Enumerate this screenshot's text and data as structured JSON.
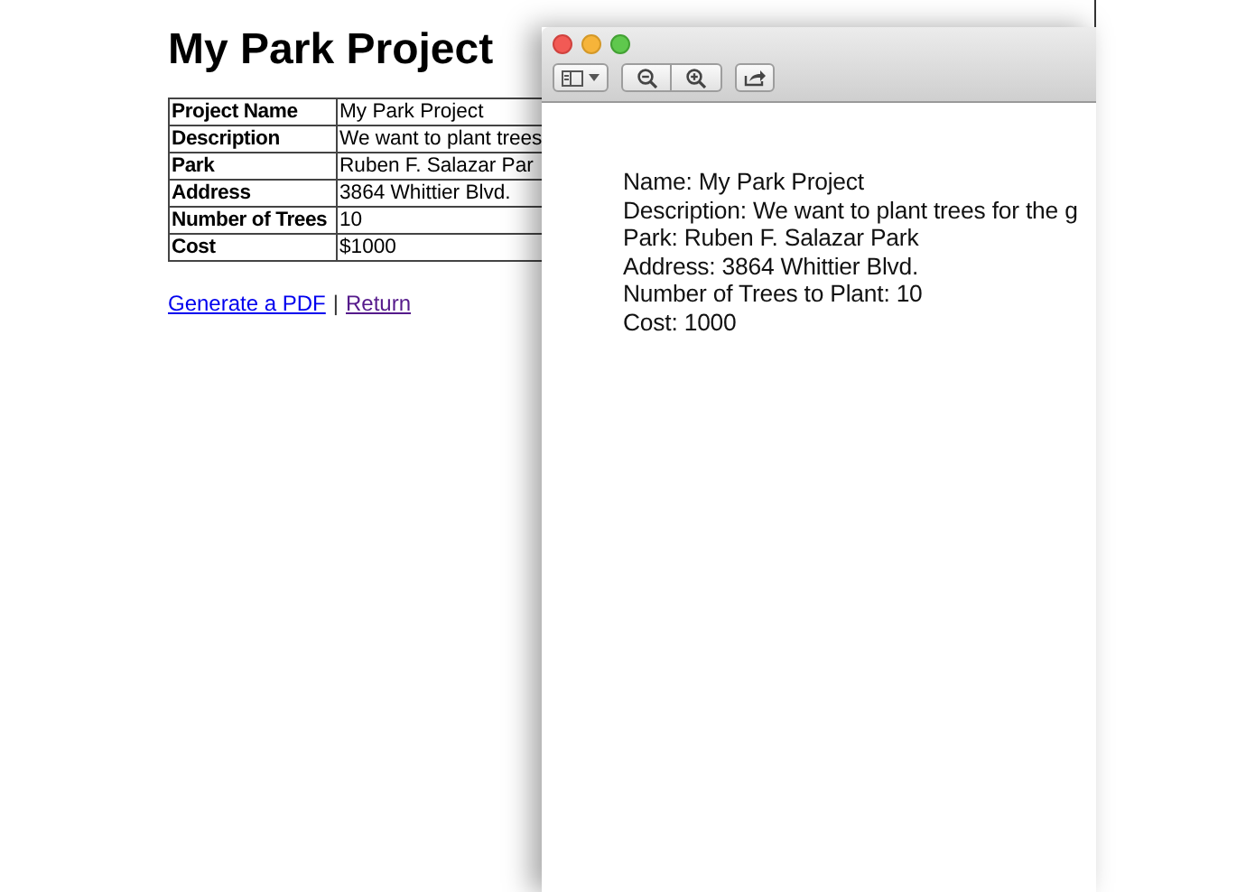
{
  "page": {
    "heading": "My Park Project",
    "table": {
      "rows": [
        {
          "label": "Project Name",
          "value": "My Park Project"
        },
        {
          "label": "Description",
          "value": "We want to plant trees"
        },
        {
          "label": "Park",
          "value": "Ruben F. Salazar Par"
        },
        {
          "label": "Address",
          "value": "3864 Whittier Blvd."
        },
        {
          "label": "Number of Trees",
          "value": "10"
        },
        {
          "label": "Cost",
          "value": "$1000"
        }
      ]
    },
    "links": [
      {
        "label": "Generate a PDF",
        "visited": false
      },
      {
        "label": "Return",
        "visited": true
      }
    ],
    "separator": "|"
  },
  "preview_window": {
    "toolbar": [
      {
        "kind": "sidebar"
      },
      {
        "kind": "zoom-out"
      },
      {
        "kind": "zoom-in"
      },
      {
        "kind": "share"
      }
    ],
    "lines": [
      "Name: My Park Project",
      "Description: We want to plant trees for the g",
      "Park: Ruben F. Salazar Park",
      "Address: 3864 Whittier Blvd.",
      "Number of Trees to Plant: 10",
      "Cost: 1000"
    ]
  }
}
